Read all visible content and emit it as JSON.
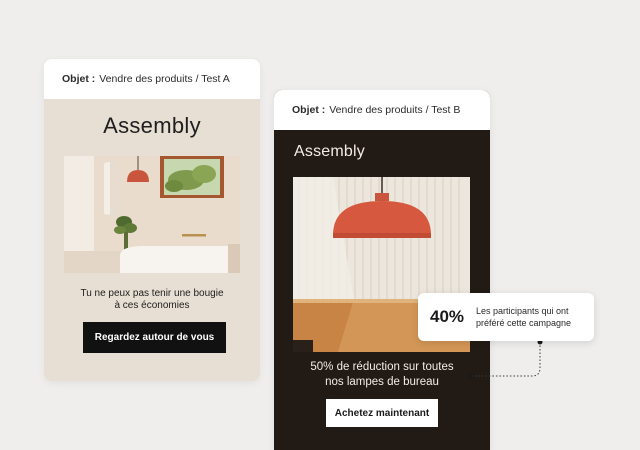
{
  "variant_a": {
    "subject_label": "Objet :",
    "subject_text": "Vendre des produits / Test A",
    "brand": "Assembly",
    "body_line1": "Tu ne peux pas tenir une bougie",
    "body_line2": "à ces économies",
    "cta_label": "Regardez autour de vous",
    "image": "bathroom-photo"
  },
  "variant_b": {
    "subject_label": "Objet :",
    "subject_text": "Vendre des produits / Test B",
    "brand": "Assembly",
    "body_line1": "50% de réduction sur toutes",
    "body_line2": "nos lampes de bureau",
    "cta_label": "Achetez maintenant",
    "image": "pendant-lamp-photo"
  },
  "stat_callout": {
    "value": "40%",
    "label_line1": "Les participants qui ont",
    "label_line2": "préféré cette campagne"
  },
  "colors": {
    "background": "#efeeec",
    "card_a_bg": "#e7dfd3",
    "card_b_bg": "#221a15",
    "accent_lamp": "#d6583f",
    "button_dark": "#111111"
  }
}
